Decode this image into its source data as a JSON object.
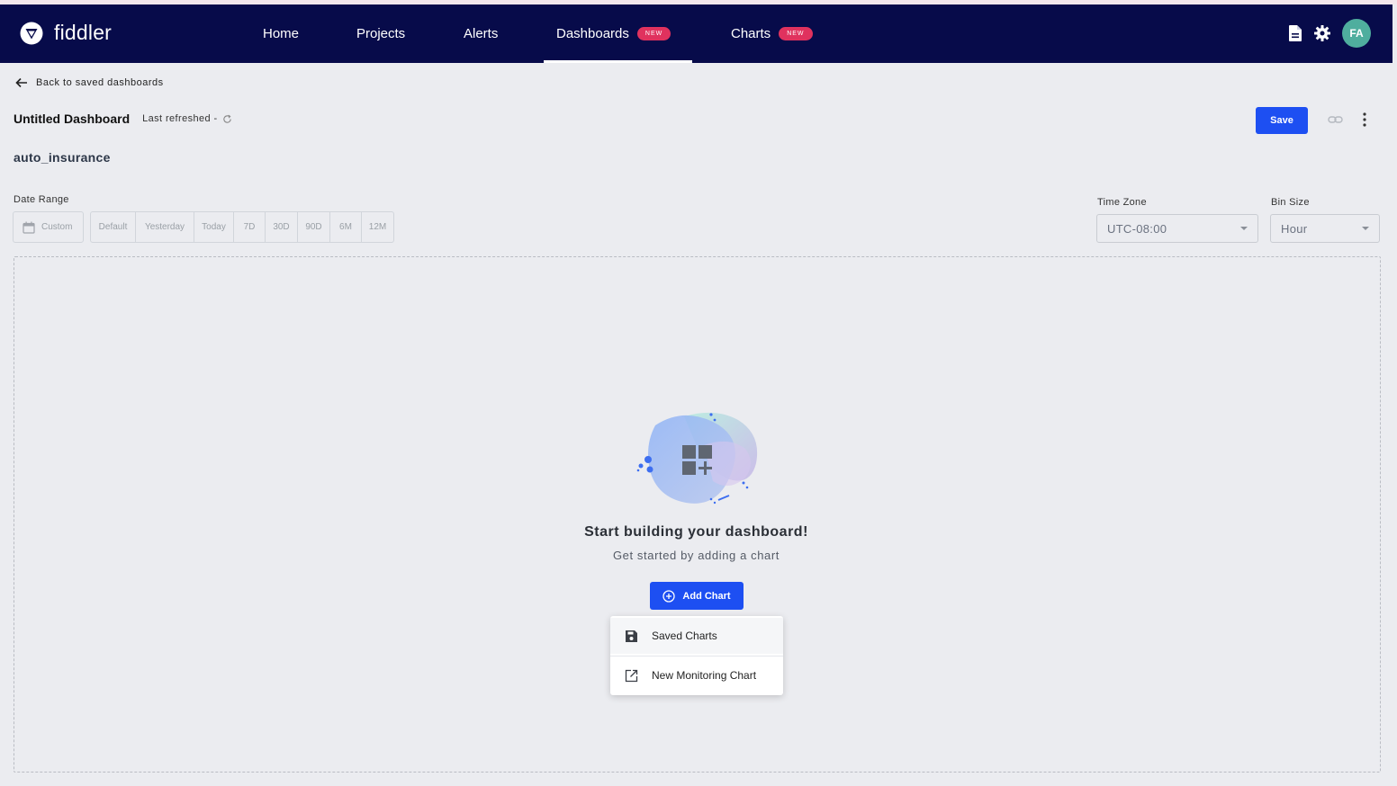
{
  "app": {
    "name": "fiddler"
  },
  "nav": {
    "items": [
      {
        "label": "Home"
      },
      {
        "label": "Projects"
      },
      {
        "label": "Alerts"
      },
      {
        "label": "Dashboards",
        "badge": "NEW",
        "active": true
      },
      {
        "label": "Charts",
        "badge": "NEW"
      }
    ],
    "icons": [
      "document-icon",
      "gear-icon"
    ],
    "avatar_initials": "FA"
  },
  "page": {
    "back_link": "Back to saved dashboards",
    "title": "Untitled Dashboard",
    "last_refreshed": "Last refreshed -",
    "save_label": "Save",
    "project": "auto_insurance"
  },
  "filters": {
    "date_range_label": "Date Range",
    "custom_label": "Custom",
    "ranges": [
      "Default",
      "Yesterday",
      "Today",
      "7D",
      "30D",
      "90D",
      "6M",
      "12M"
    ],
    "time_zone_label": "Time Zone",
    "time_zone_value": "UTC-08:00",
    "bin_size_label": "Bin Size",
    "bin_size_value": "Hour"
  },
  "empty_state": {
    "title": "Start building your dashboard!",
    "subtitle": "Get started by adding a chart",
    "add_chart_label": "Add Chart"
  },
  "menu": {
    "items": [
      {
        "label": "Saved Charts",
        "icon": "floppy-disk-icon"
      },
      {
        "label": "New Monitoring Chart",
        "icon": "open-external-icon"
      }
    ]
  },
  "colors": {
    "navbar": "#070b4a",
    "primary": "#1d4ff2",
    "badge": "#e0325e",
    "avatar": "#4fae9e",
    "background": "#ebecf0"
  }
}
